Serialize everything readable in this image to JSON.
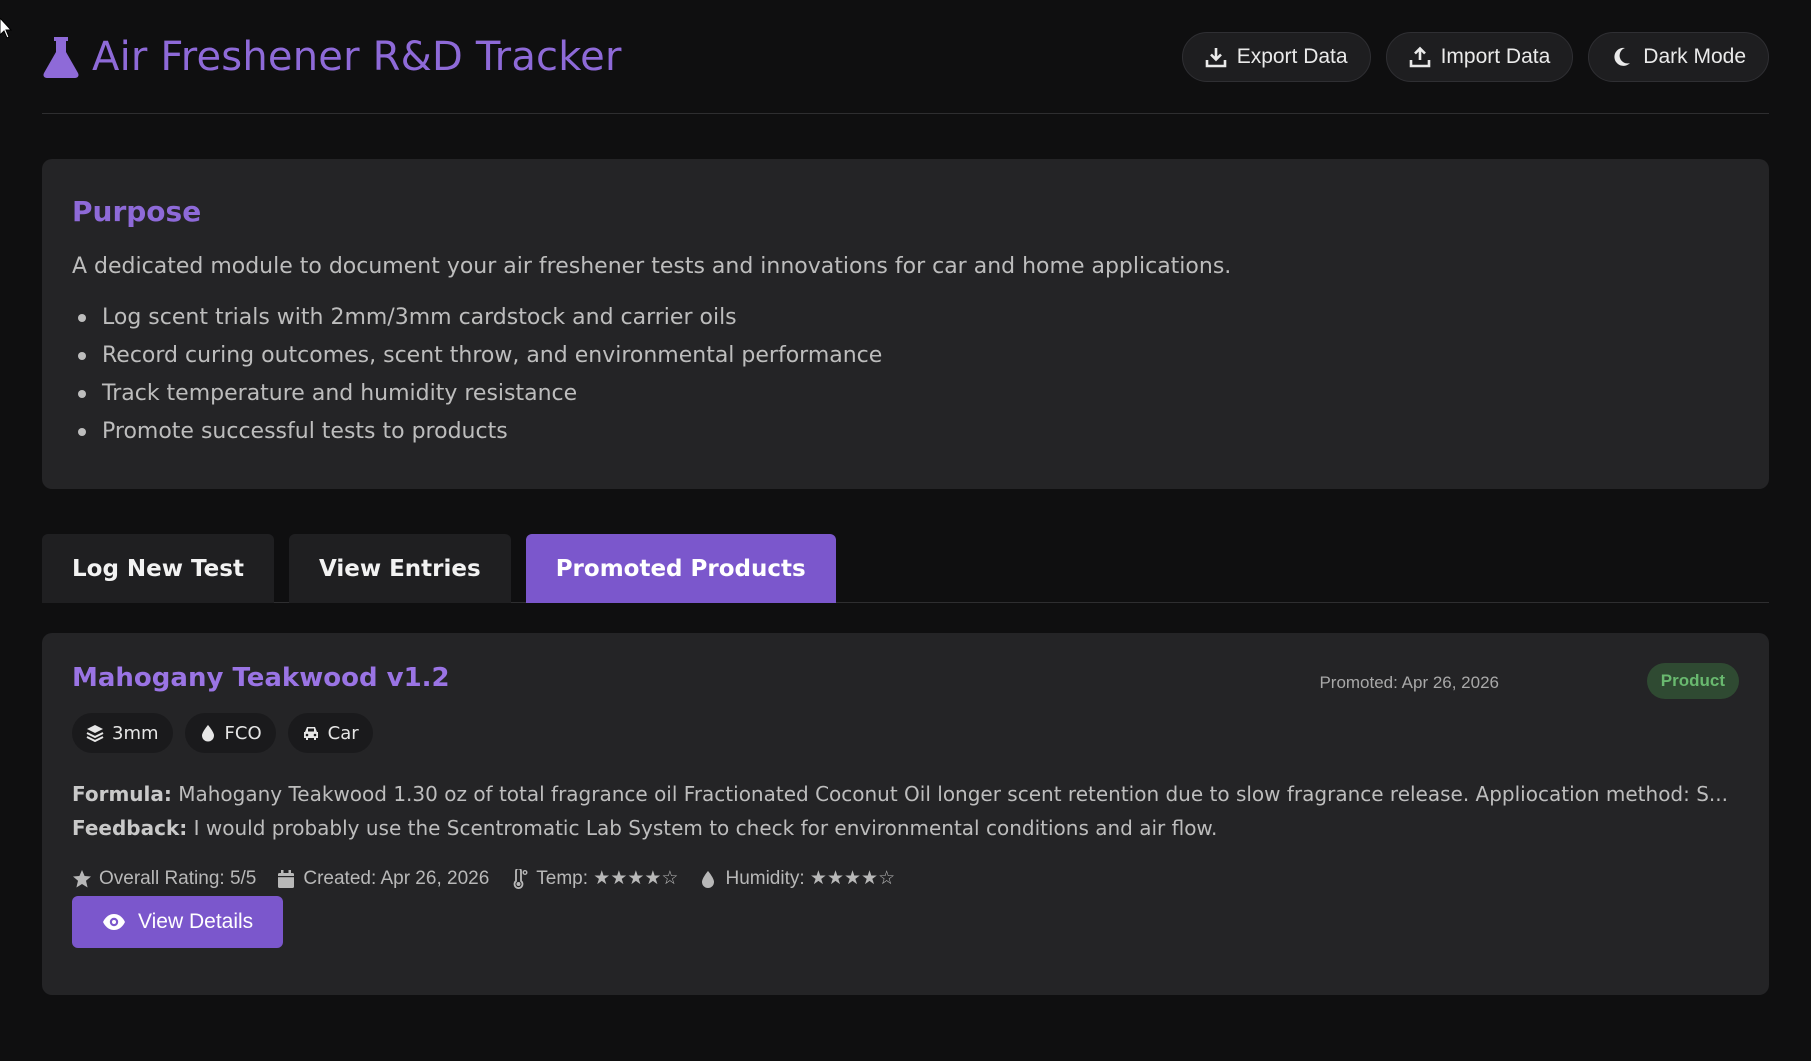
{
  "app": {
    "title": "Air Freshener R&D Tracker"
  },
  "header": {
    "export_label": "Export Data",
    "import_label": "Import Data",
    "theme_label": "Dark Mode"
  },
  "purpose": {
    "heading": "Purpose",
    "description": "A dedicated module to document your air freshener tests and innovations for car and home applications.",
    "bullets": [
      "Log scent trials with 2mm/3mm cardstock and carrier oils",
      "Record curing outcomes, scent throw, and environmental performance",
      "Track temperature and humidity resistance",
      "Promote successful tests to products"
    ]
  },
  "tabs": [
    {
      "label": "Log New Test"
    },
    {
      "label": "View Entries"
    },
    {
      "label": "Promoted Products"
    }
  ],
  "product": {
    "title": "Mahogany Teakwood v1.2",
    "promoted": "Promoted: Apr 26, 2026",
    "badge": "Product",
    "chips": [
      "3mm",
      "FCO",
      "Car"
    ],
    "formula_label": "Formula:",
    "formula": " Mahogany Teakwood 1.30 oz of total fragrance oil Fractionated Coconut Oil longer scent retention due to slow fragrance release. Appliocation method: S...",
    "feedback_label": "Feedback:",
    "feedback": " I would probably use the Scentromatic Lab System to check for environmental conditions and air flow.",
    "rating": "Overall Rating: 5/5",
    "created": "Created: Apr 26, 2026",
    "temp": "Temp: ★★★★☆",
    "humidity": "Humidity: ★★★★☆",
    "view_label": "View Details"
  },
  "colors": {
    "accent": "#7b57cc",
    "title": "#8e6ad8",
    "badge_bg": "#2f4a32",
    "badge_text": "#69b96f"
  }
}
